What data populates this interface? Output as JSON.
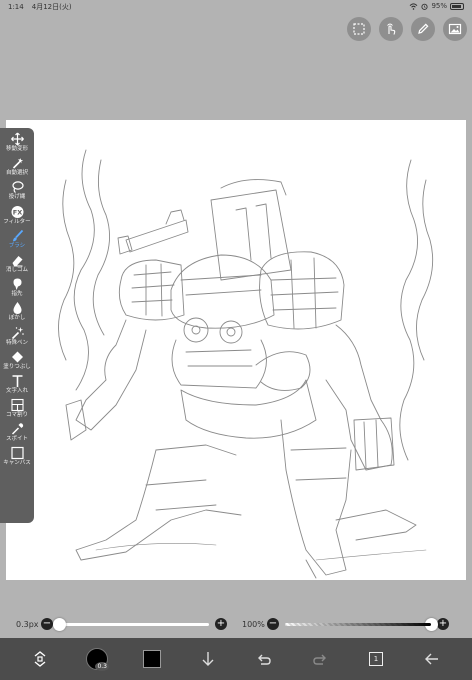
{
  "status_bar": {
    "time": "1:14",
    "date": "4月12日(火)",
    "battery": "95%"
  },
  "top_buttons": [
    {
      "name": "selection-icon"
    },
    {
      "name": "hand-touch-icon"
    },
    {
      "name": "pencil-icon"
    },
    {
      "name": "image-icon"
    }
  ],
  "tools": [
    {
      "key": "move",
      "label": "移動変形",
      "icon": "move-arrows-icon"
    },
    {
      "key": "magicwand",
      "label": "自動選択",
      "icon": "magic-wand-icon"
    },
    {
      "key": "lasso",
      "label": "投げ縄",
      "icon": "lasso-icon"
    },
    {
      "key": "filter",
      "label": "フィルター",
      "icon": "fx-icon"
    },
    {
      "key": "brush",
      "label": "ブラシ",
      "icon": "brush-icon"
    },
    {
      "key": "eraser",
      "label": "消しゴム",
      "icon": "eraser-icon"
    },
    {
      "key": "finger",
      "label": "指先",
      "icon": "finger-icon"
    },
    {
      "key": "blur",
      "label": "ぼかし",
      "icon": "drop-icon"
    },
    {
      "key": "special",
      "label": "特殊ペン",
      "icon": "sparkle-pen-icon"
    },
    {
      "key": "fill",
      "label": "塗りつぶし",
      "icon": "fill-icon"
    },
    {
      "key": "text",
      "label": "文字入れ",
      "icon": "text-icon"
    },
    {
      "key": "frame",
      "label": "コマ割り",
      "icon": "frame-icon"
    },
    {
      "key": "eyedropper",
      "label": "スポイト",
      "icon": "eyedropper-icon"
    },
    {
      "key": "canvas",
      "label": "キャンバス",
      "icon": "canvas-icon"
    }
  ],
  "active_tool": "brush",
  "sliders": {
    "size_label": "0.3px",
    "size_fraction": 0.0,
    "opacity_label": "100%",
    "opacity_fraction": 1.0,
    "minus": "−",
    "plus": "+"
  },
  "bottom_bar": {
    "brush_size_value": "0.3",
    "color": "#000000",
    "layer_count": "1"
  },
  "colors": {
    "active_tool": "#5aa9ff",
    "toolbox_bg": "#5f5f5f",
    "bottom_bar_bg": "#4c4c4c",
    "workspace_bg": "#b3b3b3"
  }
}
